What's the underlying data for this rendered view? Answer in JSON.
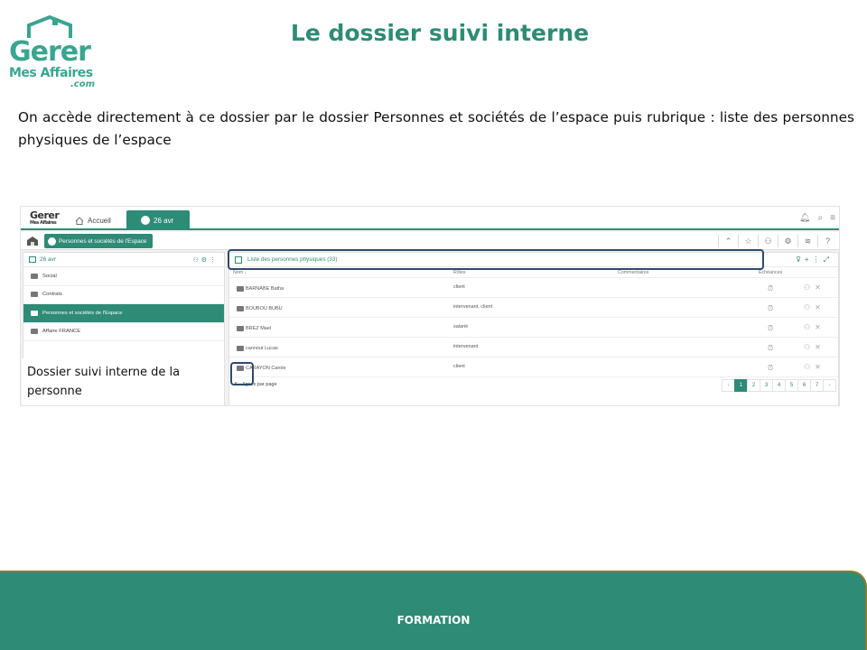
{
  "slide": {
    "title": "Le dossier suivi interne",
    "intro": "On accède directement à ce dossier par le dossier Personnes et sociétés de l’espace puis rubrique : liste des personnes physiques de l’espace",
    "callout": "Dossier suivi interne de la personne",
    "footer": "FORMATION",
    "logo": {
      "line1": "Gerer",
      "line2": "Mes Affaires",
      "line3": ".com"
    },
    "colors": {
      "accent": "#2e8b76",
      "highlight": "#2f4a6a",
      "footer_border": "#8a7e2a"
    }
  },
  "app": {
    "logo": {
      "line1": "Gerer",
      "line2": "Mes Affaires"
    },
    "tabs": {
      "home": "Accueil",
      "active": "26 avr"
    },
    "topbar_icons": [
      "bell-icon",
      "search-icon",
      "menu-icon"
    ],
    "breadcrumb": "Personnes et sociétés de l'Espace",
    "breadcrumb_tools": [
      "chevron-up-icon",
      "star-icon",
      "user-icon",
      "gear-icon",
      "layers-icon",
      "help-icon"
    ],
    "left_panel": {
      "title": "26 avr",
      "items": [
        {
          "label": "Social"
        },
        {
          "label": "Contrats"
        },
        {
          "label": "Personnes et sociétés de l'Espace"
        },
        {
          "label": "Affaire FRANCE"
        }
      ]
    },
    "main_panel": {
      "title": "Liste des personnes physiques (33)",
      "columns": {
        "name": "Nom ↓",
        "roles": "Rôles",
        "comments": "Commentaires",
        "due": "Échéances"
      },
      "rows": [
        {
          "name": "BARNABE Batha",
          "role": "client"
        },
        {
          "name": "BOUBOU BUBU",
          "role": "intervenant, client"
        },
        {
          "name": "BREZ Mael",
          "role": "salarié"
        },
        {
          "name": "cannout Lucas",
          "role": "intervenant"
        },
        {
          "name": "CARAYON Carole",
          "role": "client"
        }
      ],
      "per_page_value": "5 ▴",
      "per_page_label": "lignes par page",
      "pages": [
        "‹",
        "1",
        "2",
        "3",
        "4",
        "5",
        "6",
        "7",
        "›"
      ],
      "current_page": "1"
    }
  }
}
